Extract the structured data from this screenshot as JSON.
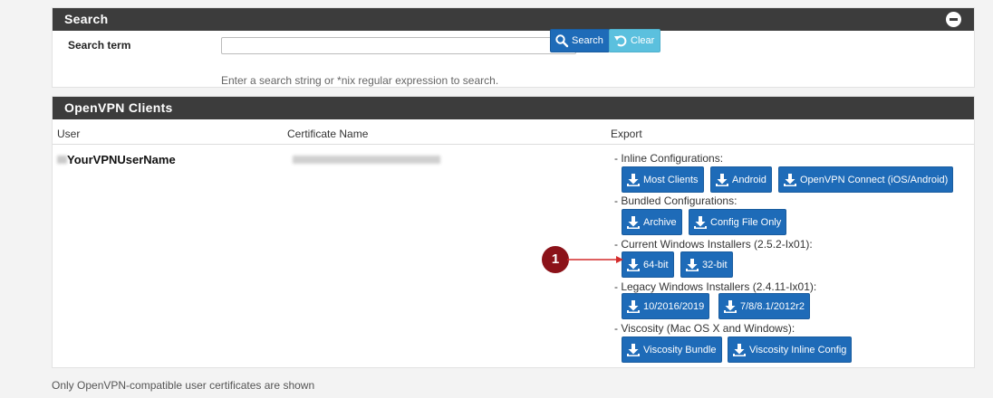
{
  "search": {
    "title": "Search",
    "label": "Search term",
    "value": "",
    "placeholder": "",
    "help": "Enter a search string or *nix regular expression to search.",
    "search_label": "Search",
    "clear_label": "Clear"
  },
  "clients": {
    "title": "OpenVPN Clients",
    "columns": {
      "user": "User",
      "cert": "Certificate Name",
      "export": "Export"
    },
    "user_name": "YourVPNUserName",
    "sections": {
      "inline": "- Inline Configurations:",
      "bundled": "- Bundled Configurations:",
      "current": "- Current Windows Installers (2.5.2-Ix01):",
      "legacy": "- Legacy Windows Installers (2.4.11-Ix01):",
      "viscosity": "- Viscosity (Mac OS X and Windows):"
    },
    "buttons": {
      "most_clients": "Most Clients",
      "android": "Android",
      "openvpn_connect": "OpenVPN Connect (iOS/Android)",
      "archive": "Archive",
      "config_file_only": "Config File Only",
      "bit64": "64-bit",
      "bit32": "32-bit",
      "legacy_10": "10/2016/2019",
      "legacy_7": "7/8/8.1/2012r2",
      "viscosity_bundle": "Viscosity Bundle",
      "viscosity_inline": "Viscosity Inline Config"
    }
  },
  "footer_note": "Only OpenVPN-compatible user certificates are shown",
  "callout": {
    "number": "1"
  },
  "colors": {
    "header_bg": "#3c3c3c",
    "primary_button": "#1e6bb8",
    "info_button": "#5bc0de",
    "callout": "#8b1219",
    "arrow": "#d42b2b"
  },
  "icons": {
    "collapse": "minus-circle-icon",
    "search": "magnifier-icon",
    "clear": "undo-icon",
    "download": "download-icon"
  }
}
